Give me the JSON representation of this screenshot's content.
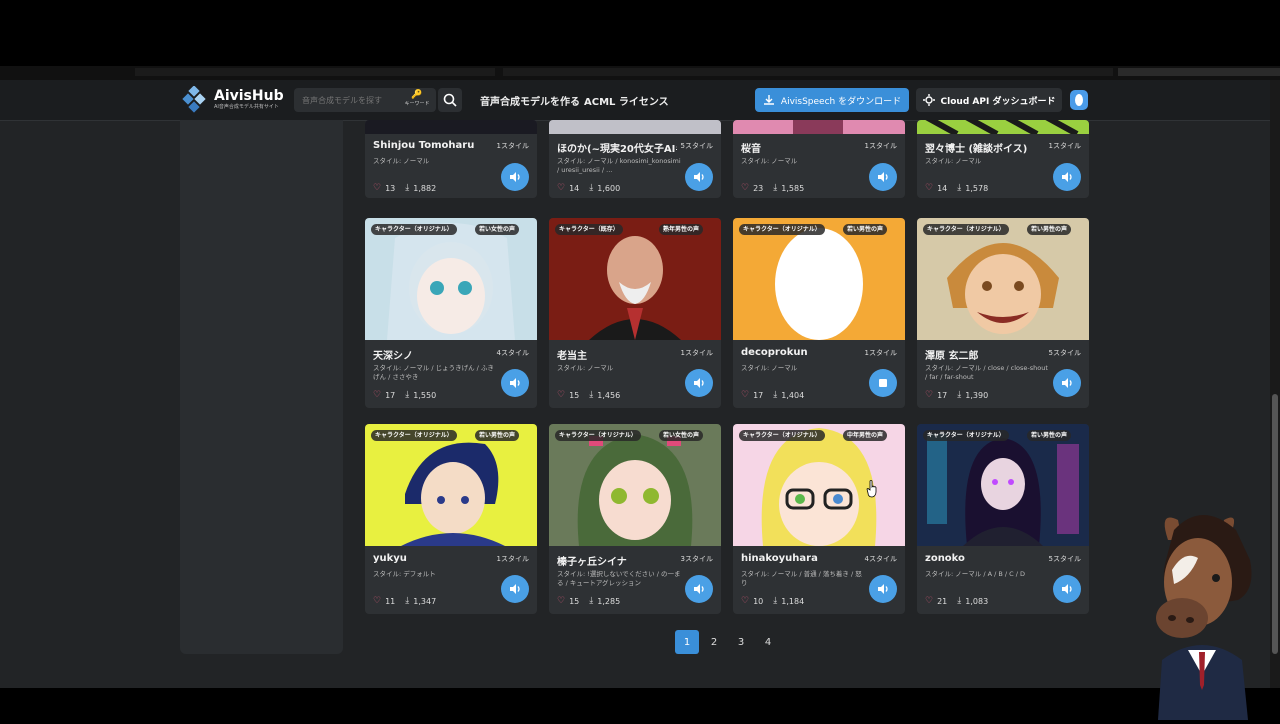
{
  "header": {
    "logo_title": "AivisHub",
    "logo_sub": "AI音声合成モデル共有サイト",
    "search_placeholder": "音声合成モデルを探す",
    "keyword_label": "キーワード",
    "nav_create": "音声合成モデルを作る",
    "nav_license": "ACML ライセンス",
    "download_label": "AivisSpeech をダウンロード",
    "cloud_label": "Cloud API ダッシュボード",
    "accent": "#3a8fd9"
  },
  "top_row": [
    {
      "name": "Shinjou Tomoharu",
      "count": "1スタイル",
      "styles": "スタイル: ノーマル",
      "likes": "13",
      "downloads": "1,882"
    },
    {
      "name": "ほのか(~現実20代女子AI#",
      "count": "5スタイル",
      "styles": "スタイル: ノーマル / konosimi_konosimi / uresii_uresii / ...",
      "likes": "14",
      "downloads": "1,600"
    },
    {
      "name": "桜音",
      "count": "1スタイル",
      "styles": "スタイル: ノーマル",
      "likes": "23",
      "downloads": "1,585"
    },
    {
      "name": "翌々博士 (雑談ボイス)",
      "count": "1スタイル",
      "styles": "スタイル: ノーマル",
      "likes": "14",
      "downloads": "1,578"
    }
  ],
  "mid_row": [
    {
      "tag1": "キャラクター（オリジナル）",
      "tag2": "若い女性の声",
      "name": "天深シノ",
      "count": "4スタイル",
      "styles": "スタイル: ノーマル / じょうきげん / ふきげん / ささやき",
      "likes": "17",
      "downloads": "1,550"
    },
    {
      "tag1": "キャラクター（既存）",
      "tag2": "熟年男性の声",
      "name": "老当主",
      "count": "1スタイル",
      "styles": "スタイル: ノーマル",
      "likes": "15",
      "downloads": "1,456"
    },
    {
      "tag1": "キャラクター（オリジナル）",
      "tag2": "若い男性の声",
      "name": "decoprokun",
      "count": "1スタイル",
      "styles": "スタイル: ノーマル",
      "likes": "17",
      "downloads": "1,404"
    },
    {
      "tag1": "キャラクター（オリジナル）",
      "tag2": "若い男性の声",
      "name": "澤原 玄二郎",
      "count": "5スタイル",
      "styles": "スタイル: ノーマル / close / close-shout / far / far-shout",
      "likes": "17",
      "downloads": "1,390"
    }
  ],
  "bot_row": [
    {
      "tag1": "キャラクター（オリジナル）",
      "tag2": "若い男性の声",
      "name": "yukyu",
      "count": "1スタイル",
      "styles": "スタイル: デフォルト",
      "likes": "11",
      "downloads": "1,347"
    },
    {
      "tag1": "キャラクター（オリジナル）",
      "tag2": "若い女性の声",
      "name": "榛子ヶ丘シイナ",
      "count": "3スタイル",
      "styles": "スタイル: !選択しないでください / の一まる / キュートアグレッション",
      "likes": "15",
      "downloads": "1,285"
    },
    {
      "tag1": "キャラクター（オリジナル）",
      "tag2": "中年男性の声",
      "name": "hinakoyuhara",
      "count": "4スタイル",
      "styles": "スタイル: ノーマル / 普通 / 落ち着き / 怒り",
      "likes": "10",
      "downloads": "1,184"
    },
    {
      "tag1": "キャラクター（オリジナル）",
      "tag2": "若い男性の声",
      "name": "zonoko",
      "count": "5スタイル",
      "styles": "スタイル: ノーマル / A / B / C / D",
      "likes": "21",
      "downloads": "1,083"
    }
  ],
  "pagination": {
    "pages": [
      "1",
      "2",
      "3",
      "4"
    ],
    "active": "1"
  },
  "icons": {
    "play": "speaker-icon",
    "stop": "stop-icon",
    "like": "heart-icon",
    "download": "download-icon"
  }
}
